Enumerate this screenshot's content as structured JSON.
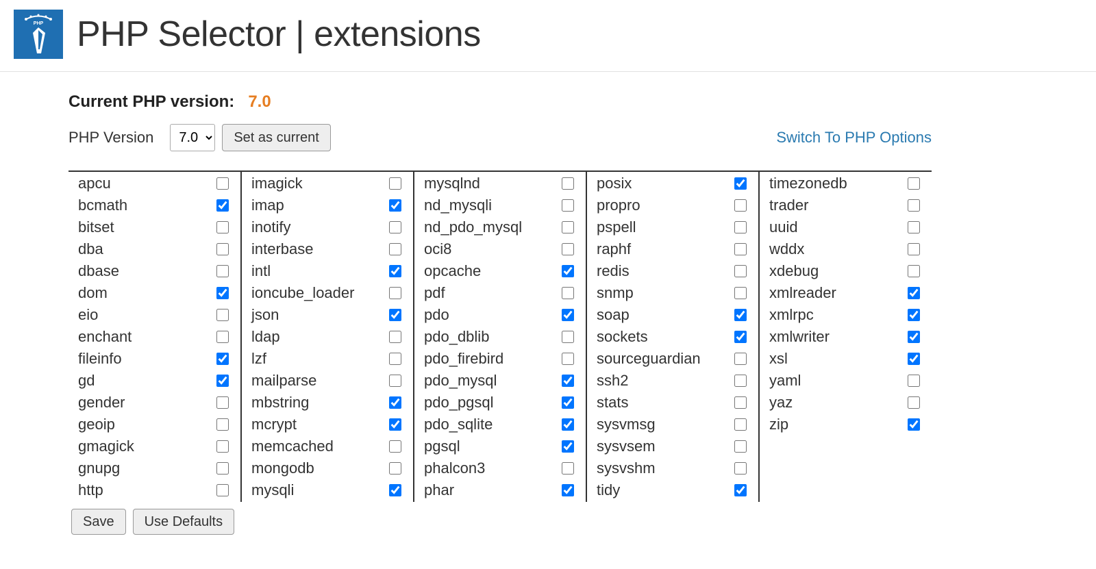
{
  "header": {
    "title": "PHP Selector | extensions"
  },
  "versionBlock": {
    "label": "Current PHP version:",
    "value": "7.0",
    "selectLabel": "PHP Version",
    "selected": "7.0",
    "setButton": "Set as current",
    "optionsLink": "Switch To PHP Options"
  },
  "extensions": {
    "columns": [
      [
        {
          "name": "apcu",
          "checked": false
        },
        {
          "name": "bcmath",
          "checked": true
        },
        {
          "name": "bitset",
          "checked": false
        },
        {
          "name": "dba",
          "checked": false
        },
        {
          "name": "dbase",
          "checked": false
        },
        {
          "name": "dom",
          "checked": true
        },
        {
          "name": "eio",
          "checked": false
        },
        {
          "name": "enchant",
          "checked": false
        },
        {
          "name": "fileinfo",
          "checked": true
        },
        {
          "name": "gd",
          "checked": true
        },
        {
          "name": "gender",
          "checked": false
        },
        {
          "name": "geoip",
          "checked": false
        },
        {
          "name": "gmagick",
          "checked": false
        },
        {
          "name": "gnupg",
          "checked": false
        },
        {
          "name": "http",
          "checked": false
        }
      ],
      [
        {
          "name": "imagick",
          "checked": false
        },
        {
          "name": "imap",
          "checked": true
        },
        {
          "name": "inotify",
          "checked": false
        },
        {
          "name": "interbase",
          "checked": false
        },
        {
          "name": "intl",
          "checked": true
        },
        {
          "name": "ioncube_loader",
          "checked": false
        },
        {
          "name": "json",
          "checked": true
        },
        {
          "name": "ldap",
          "checked": false
        },
        {
          "name": "lzf",
          "checked": false
        },
        {
          "name": "mailparse",
          "checked": false
        },
        {
          "name": "mbstring",
          "checked": true
        },
        {
          "name": "mcrypt",
          "checked": true
        },
        {
          "name": "memcached",
          "checked": false
        },
        {
          "name": "mongodb",
          "checked": false
        },
        {
          "name": "mysqli",
          "checked": true
        }
      ],
      [
        {
          "name": "mysqlnd",
          "checked": false
        },
        {
          "name": "nd_mysqli",
          "checked": false
        },
        {
          "name": "nd_pdo_mysql",
          "checked": false
        },
        {
          "name": "oci8",
          "checked": false
        },
        {
          "name": "opcache",
          "checked": true
        },
        {
          "name": "pdf",
          "checked": false
        },
        {
          "name": "pdo",
          "checked": true
        },
        {
          "name": "pdo_dblib",
          "checked": false
        },
        {
          "name": "pdo_firebird",
          "checked": false
        },
        {
          "name": "pdo_mysql",
          "checked": true
        },
        {
          "name": "pdo_pgsql",
          "checked": true
        },
        {
          "name": "pdo_sqlite",
          "checked": true
        },
        {
          "name": "pgsql",
          "checked": true
        },
        {
          "name": "phalcon3",
          "checked": false
        },
        {
          "name": "phar",
          "checked": true
        }
      ],
      [
        {
          "name": "posix",
          "checked": true
        },
        {
          "name": "propro",
          "checked": false
        },
        {
          "name": "pspell",
          "checked": false
        },
        {
          "name": "raphf",
          "checked": false
        },
        {
          "name": "redis",
          "checked": false
        },
        {
          "name": "snmp",
          "checked": false
        },
        {
          "name": "soap",
          "checked": true
        },
        {
          "name": "sockets",
          "checked": true
        },
        {
          "name": "sourceguardian",
          "checked": false
        },
        {
          "name": "ssh2",
          "checked": false
        },
        {
          "name": "stats",
          "checked": false
        },
        {
          "name": "sysvmsg",
          "checked": false
        },
        {
          "name": "sysvsem",
          "checked": false
        },
        {
          "name": "sysvshm",
          "checked": false
        },
        {
          "name": "tidy",
          "checked": true
        }
      ],
      [
        {
          "name": "timezonedb",
          "checked": false
        },
        {
          "name": "trader",
          "checked": false
        },
        {
          "name": "uuid",
          "checked": false
        },
        {
          "name": "wddx",
          "checked": false
        },
        {
          "name": "xdebug",
          "checked": false
        },
        {
          "name": "xmlreader",
          "checked": true
        },
        {
          "name": "xmlrpc",
          "checked": true
        },
        {
          "name": "xmlwriter",
          "checked": true
        },
        {
          "name": "xsl",
          "checked": true
        },
        {
          "name": "yaml",
          "checked": false
        },
        {
          "name": "yaz",
          "checked": false
        },
        {
          "name": "zip",
          "checked": true
        }
      ]
    ]
  },
  "footer": {
    "save": "Save",
    "defaults": "Use Defaults"
  }
}
